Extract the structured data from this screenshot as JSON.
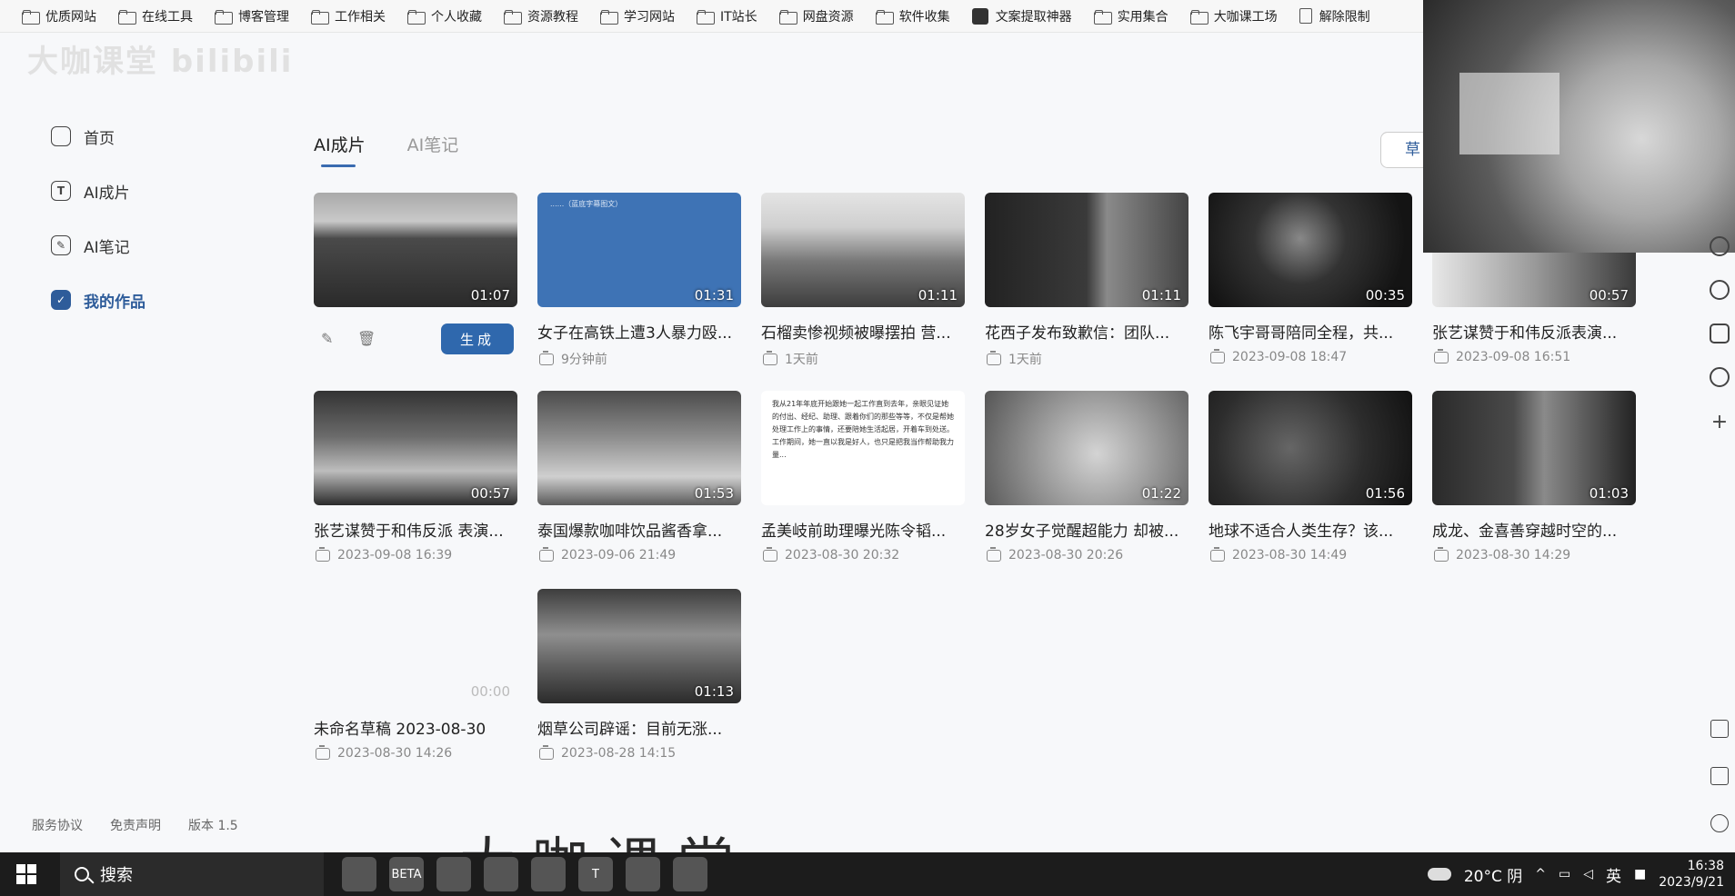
{
  "bookmarks": [
    {
      "label": "优质网站",
      "icon": "folder-icon"
    },
    {
      "label": "在线工具",
      "icon": "folder-icon"
    },
    {
      "label": "博客管理",
      "icon": "folder-icon"
    },
    {
      "label": "工作相关",
      "icon": "folder-icon"
    },
    {
      "label": "个人收藏",
      "icon": "folder-icon"
    },
    {
      "label": "资源教程",
      "icon": "folder-icon"
    },
    {
      "label": "学习网站",
      "icon": "folder-icon"
    },
    {
      "label": "IT站长",
      "icon": "folder-icon"
    },
    {
      "label": "网盘资源",
      "icon": "folder-icon"
    },
    {
      "label": "软件收集",
      "icon": "folder-icon"
    },
    {
      "label": "文案提取神器",
      "icon": "app-icon"
    },
    {
      "label": "实用集合",
      "icon": "folder-icon"
    },
    {
      "label": "大咖课工场",
      "icon": "folder-icon"
    },
    {
      "label": "解除限制",
      "icon": "page-icon"
    }
  ],
  "watermark": {
    "top": "大咖课堂 bilibili",
    "bottom": "大咖课堂"
  },
  "sidebar": {
    "items": [
      {
        "label": "首页",
        "icon": "home-icon",
        "glyph": ""
      },
      {
        "label": "AI成片",
        "icon": "text-t-icon",
        "glyph": "T"
      },
      {
        "label": "AI笔记",
        "icon": "pen-note-icon",
        "glyph": "✎"
      },
      {
        "label": "我的作品",
        "icon": "my-works-icon",
        "glyph": "✓"
      }
    ],
    "active_index": 3,
    "footer": {
      "terms": "服务协议",
      "disclaimer": "免责声明",
      "version": "版本 1.5"
    }
  },
  "tabs": {
    "items": [
      "AI成片",
      "AI笔记"
    ],
    "active_index": 0
  },
  "draft_button": "草",
  "first_card_actions": {
    "edit_icon": "edit-icon",
    "delete_icon": "trash-icon",
    "generate": "生成"
  },
  "cards": [
    {
      "title": "",
      "meta": "",
      "duration": "01:07",
      "thumb_text": ""
    },
    {
      "title": "女子在高铁上遭3人暴力殴...",
      "meta": "9分钟前",
      "duration": "01:31",
      "thumb_text": "......（蓝底字幕图文）"
    },
    {
      "title": "石榴卖惨视频被曝摆拍 营...",
      "meta": "1天前",
      "duration": "01:11",
      "thumb_text": ""
    },
    {
      "title": "花西子发布致歉信：团队...",
      "meta": "1天前",
      "duration": "01:11",
      "thumb_text": ""
    },
    {
      "title": "陈飞宇哥哥陪同全程，共...",
      "meta": "2023-09-08 18:47",
      "duration": "00:35",
      "thumb_text": ""
    },
    {
      "title": "张艺谋赞于和伟反派表演...",
      "meta": "2023-09-08 16:51",
      "duration": "00:57",
      "thumb_text": ""
    },
    {
      "title": "张艺谋赞于和伟反派 表演...",
      "meta": "2023-09-08 16:39",
      "duration": "00:57",
      "thumb_text": ""
    },
    {
      "title": "泰国爆款咖啡饮品酱香拿...",
      "meta": "2023-09-06 21:49",
      "duration": "01:53",
      "thumb_text": ""
    },
    {
      "title": "孟美岐前助理曝光陈令韬...",
      "meta": "2023-08-30 20:32",
      "duration": "",
      "thumb_text": "我从21年年底开始跟她一起工作直到去年，亲眼见证她的付出、经纪、助理、跟着你们的那些等等，不仅是帮她处理工作上的事情，还要陪她生活起居，开着车到处送。工作期间，她一直以我是好人，也只是把我当作帮助我力量..."
    },
    {
      "title": "28岁女子觉醒超能力 却被...",
      "meta": "2023-08-30 20:26",
      "duration": "01:22",
      "thumb_text": ""
    },
    {
      "title": "地球不适合人类生存？该...",
      "meta": "2023-08-30 14:49",
      "duration": "01:56",
      "thumb_text": ""
    },
    {
      "title": "成龙、金喜善穿越时空的...",
      "meta": "2023-08-30 14:29",
      "duration": "01:03",
      "thumb_text": ""
    },
    {
      "title": "未命名草稿 2023-08-30",
      "meta": "2023-08-30 14:26",
      "duration": "00:00",
      "thumb_text": ""
    },
    {
      "title": "烟草公司辟谣：目前无涨...",
      "meta": "2023-08-28 14:15",
      "duration": "01:13",
      "thumb_text": ""
    }
  ],
  "taskbar": {
    "search_placeholder": "搜索",
    "weather": "20°C 阴",
    "ime": "英",
    "time": "16:38",
    "date": "2023/9/21",
    "apps": [
      "app-icon",
      "BETA",
      "app-icon",
      "app-icon",
      "app-icon",
      "T",
      "app-icon",
      "app-icon"
    ]
  }
}
